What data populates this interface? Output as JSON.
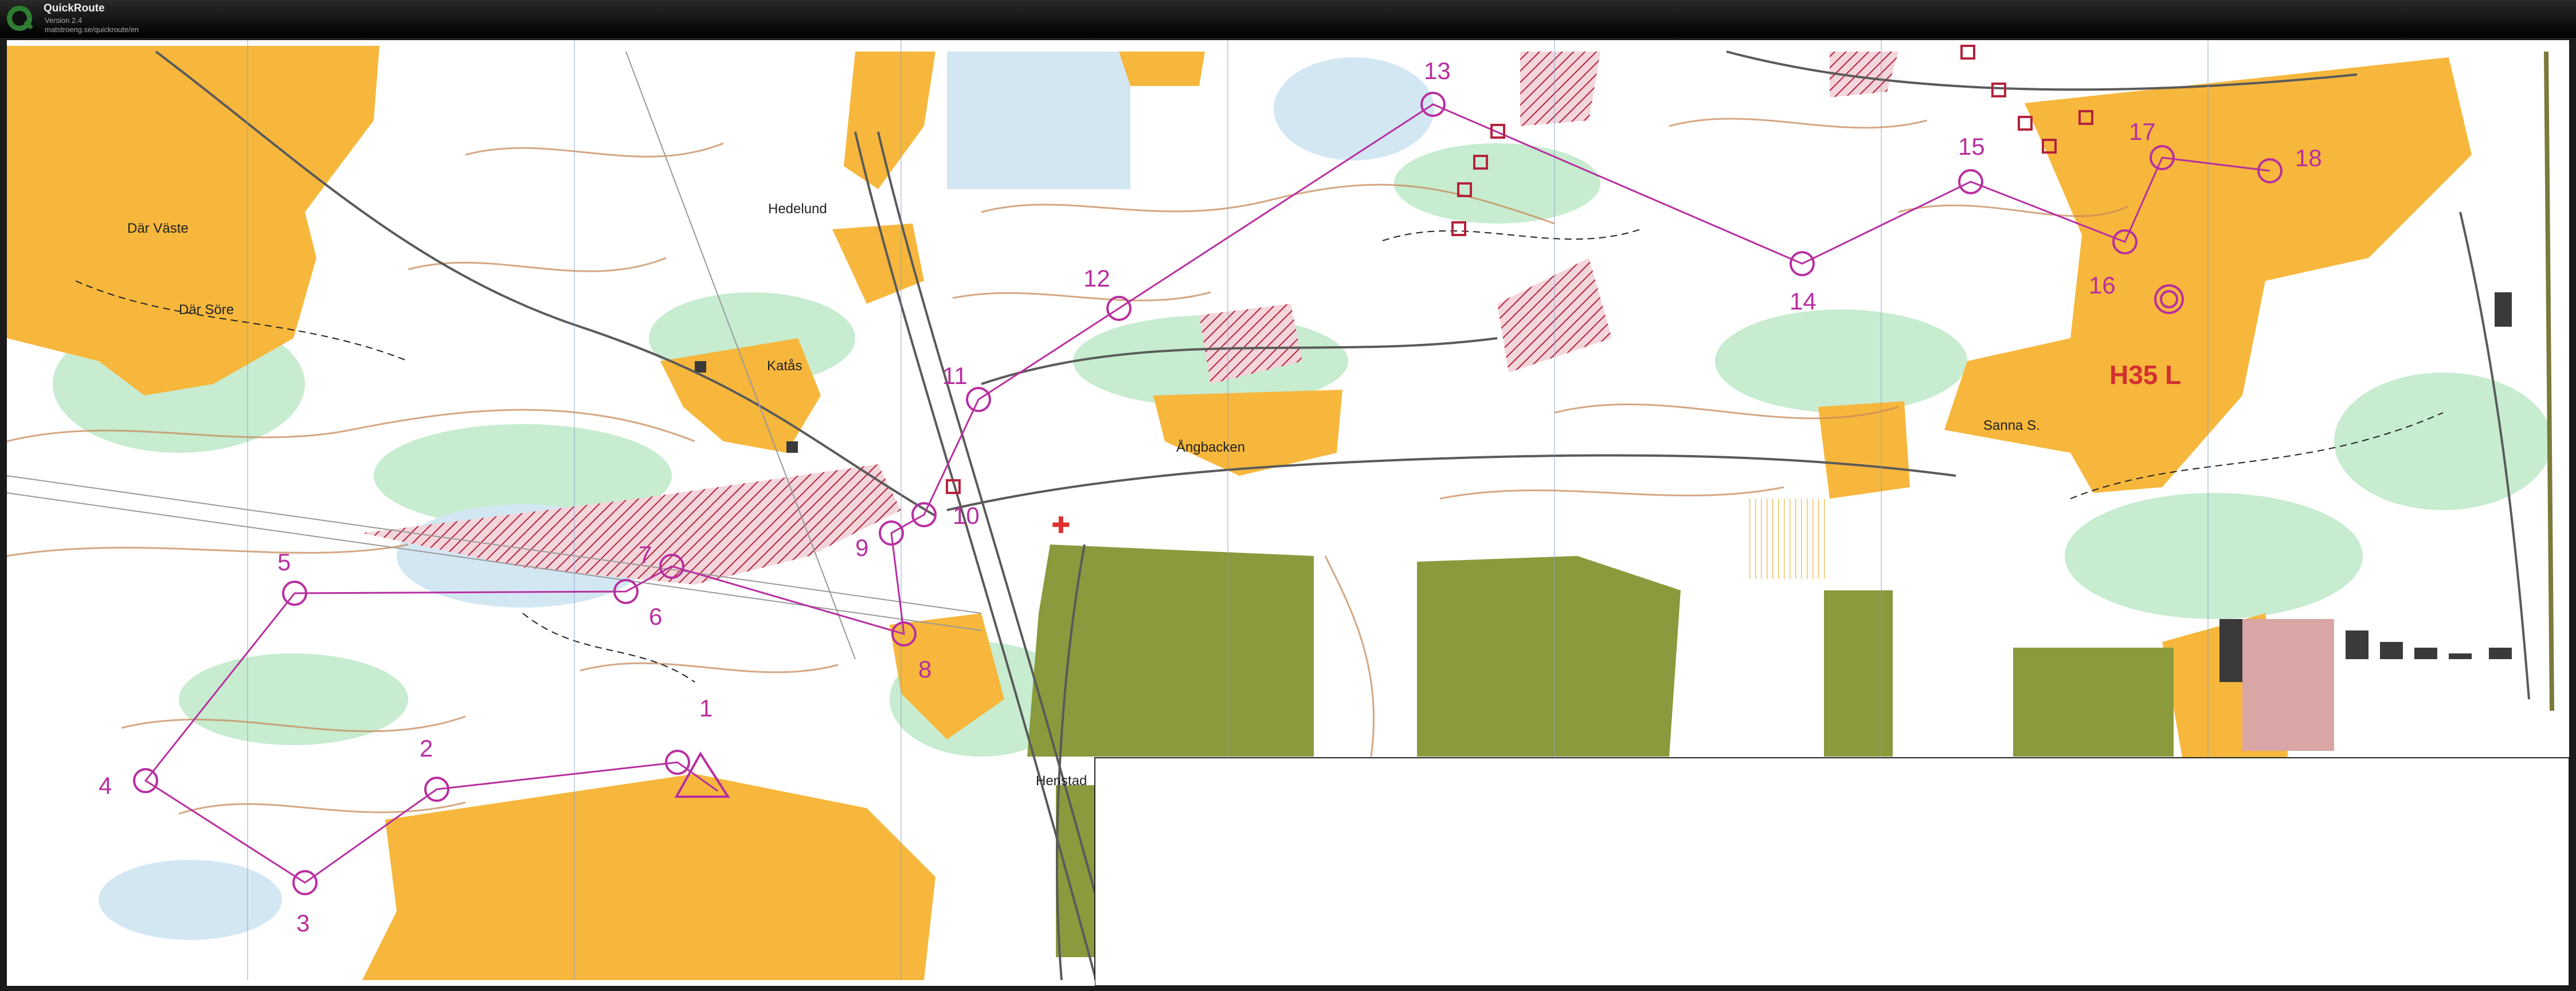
{
  "app": {
    "title": "QuickRoute",
    "version": "Version 2.4",
    "url": "matstroeng.se/quickroute/en"
  },
  "map": {
    "course_label": "H35 L",
    "place_names": [
      "Där Väste",
      "Där Söre",
      "Hedelund",
      "Katås",
      "Ångbacken",
      "Henstad",
      "Sanna S."
    ],
    "controls": [
      "1",
      "2",
      "3",
      "4",
      "5",
      "6",
      "7",
      "8",
      "9",
      "10",
      "11",
      "12",
      "13",
      "14",
      "15",
      "16",
      "17",
      "18"
    ]
  },
  "colors": {
    "course": "#b82ea0",
    "open_land": "#f6b73c",
    "forest_green": "#bfe8c8",
    "water": "#a6cfe8",
    "housing": "#8a9a3c"
  }
}
